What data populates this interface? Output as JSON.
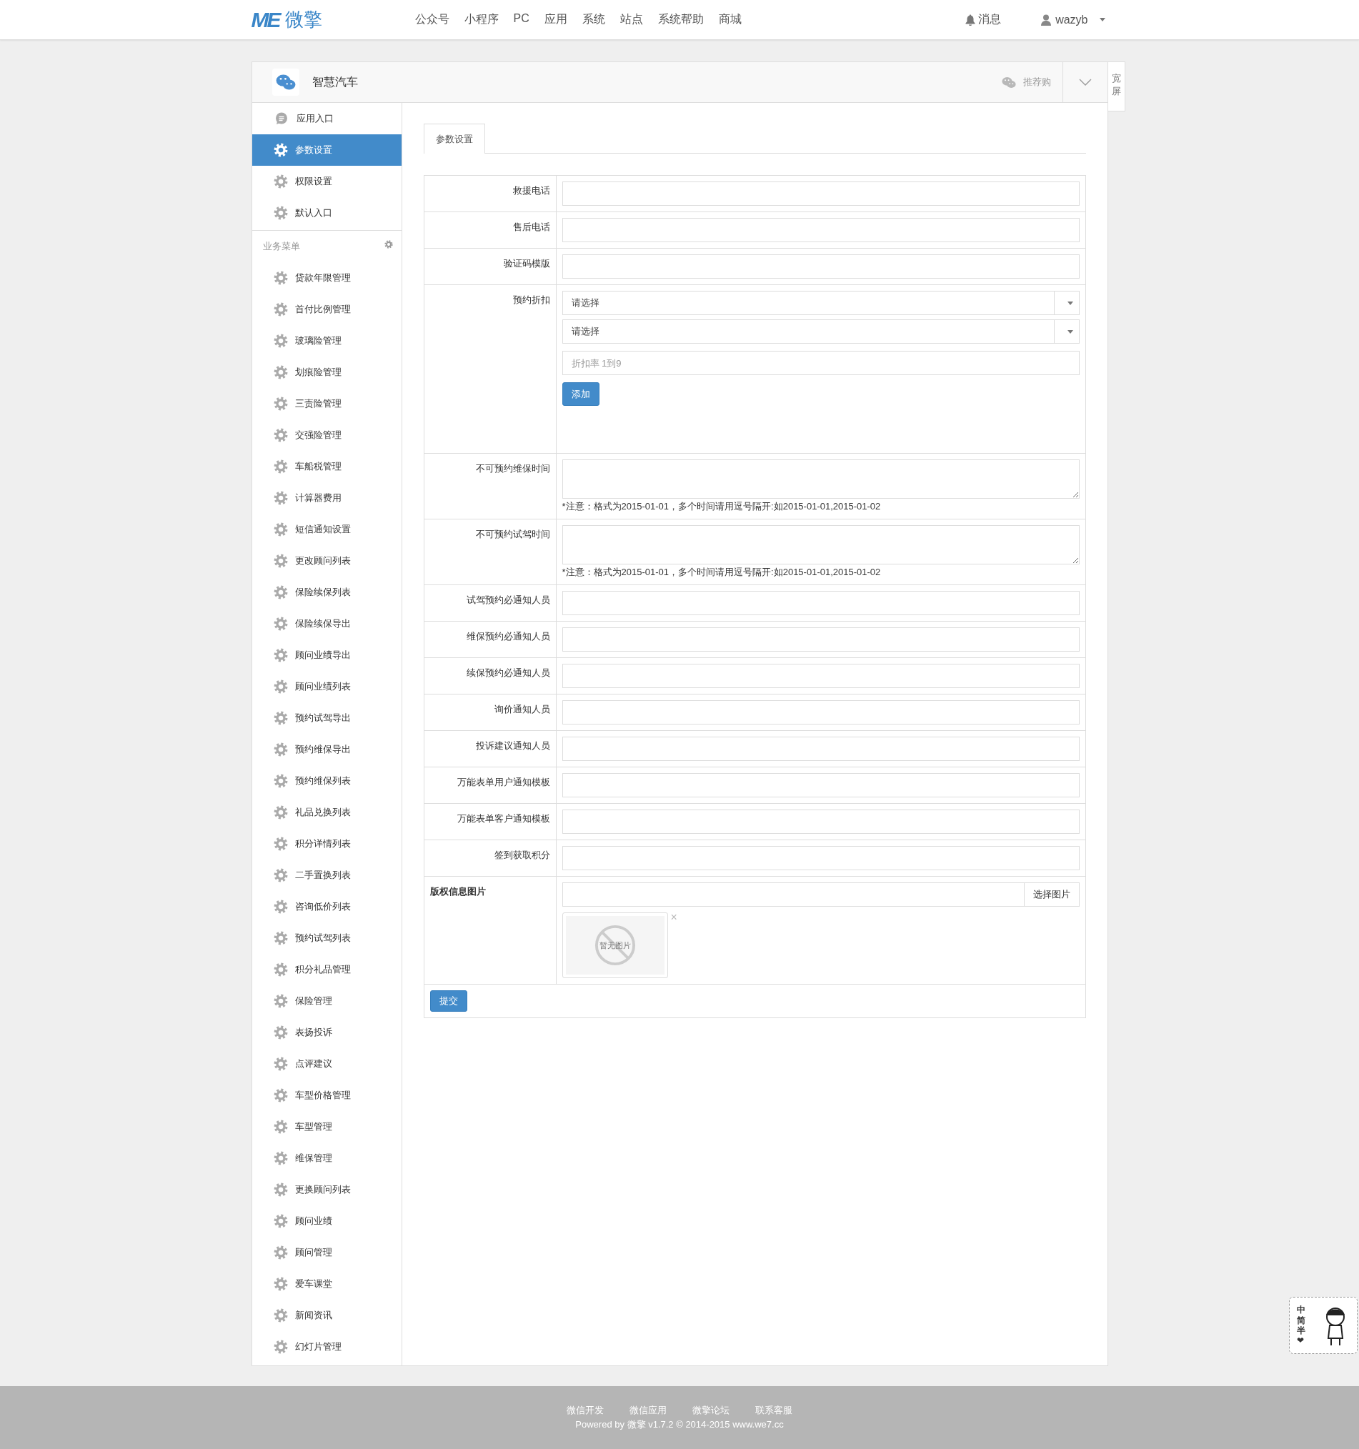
{
  "topbar": {
    "logo": {
      "mark": "ME",
      "name": "微擎"
    },
    "nav": [
      {
        "label": "公众号"
      },
      {
        "label": "小程序"
      },
      {
        "label": "PC"
      },
      {
        "label": "应用"
      },
      {
        "label": "系统"
      },
      {
        "label": "站点"
      },
      {
        "label": "系统帮助"
      },
      {
        "label": "商城"
      }
    ],
    "messages": "消息",
    "user": "wazyb"
  },
  "panel": {
    "title": "智慧汽车",
    "recommend": "推荐购",
    "widescreen": "宽屏"
  },
  "sidebar": {
    "items": [
      {
        "label": "应用入口",
        "kind": "chat",
        "selected": false
      },
      {
        "label": "参数设置",
        "kind": "gear",
        "selected": true
      },
      {
        "label": "权限设置",
        "kind": "gear",
        "selected": false
      },
      {
        "label": "默认入口",
        "kind": "gear",
        "selected": false
      }
    ],
    "section": {
      "title": "业务菜单",
      "items": [
        {
          "label": "贷款年限管理",
          "selected": false
        },
        {
          "label": "首付比例管理",
          "selected": false
        },
        {
          "label": "玻璃险管理",
          "selected": false
        },
        {
          "label": "划痕险管理",
          "selected": false
        },
        {
          "label": "三责险管理",
          "selected": false
        },
        {
          "label": "交强险管理",
          "selected": false
        },
        {
          "label": "车船税管理",
          "selected": false
        },
        {
          "label": "计算器费用",
          "selected": false
        },
        {
          "label": "短信通知设置",
          "selected": false
        },
        {
          "label": "更改顾问列表",
          "selected": false
        },
        {
          "label": "保险续保列表",
          "selected": false
        },
        {
          "label": "保险续保导出",
          "selected": false
        },
        {
          "label": "顾问业绩导出",
          "selected": false
        },
        {
          "label": "顾问业绩列表",
          "selected": false
        },
        {
          "label": "预约试驾导出",
          "selected": false
        },
        {
          "label": "预约维保导出",
          "selected": false
        },
        {
          "label": "预约维保列表",
          "selected": false
        },
        {
          "label": "礼品兑换列表",
          "selected": false
        },
        {
          "label": "积分详情列表",
          "selected": false
        },
        {
          "label": "二手置换列表",
          "selected": false
        },
        {
          "label": "咨询低价列表",
          "selected": false
        },
        {
          "label": "预约试驾列表",
          "selected": false
        },
        {
          "label": "积分礼品管理",
          "selected": false
        },
        {
          "label": "保险管理",
          "selected": false
        },
        {
          "label": "表扬投诉",
          "selected": false
        },
        {
          "label": "点评建议",
          "selected": false
        },
        {
          "label": "车型价格管理",
          "selected": false
        },
        {
          "label": "车型管理",
          "selected": false
        },
        {
          "label": "维保管理",
          "selected": false
        },
        {
          "label": "更换顾问列表",
          "selected": false
        },
        {
          "label": "顾问业绩",
          "selected": false
        },
        {
          "label": "顾问管理",
          "selected": false
        },
        {
          "label": "爱车课堂",
          "selected": false
        },
        {
          "label": "新闻资讯",
          "selected": false
        },
        {
          "label": "幻灯片管理",
          "selected": false
        }
      ]
    }
  },
  "tabs": [
    {
      "label": "参数设置",
      "selected": true
    }
  ],
  "form": {
    "rows": [
      {
        "kind": "text",
        "label": "救援电话"
      },
      {
        "kind": "text",
        "label": "售后电话"
      },
      {
        "kind": "text",
        "label": "验证码模版"
      },
      {
        "kind": "discount",
        "label": "预约折扣",
        "selects": [
          {
            "value": "请选择"
          },
          {
            "value": "请选择"
          }
        ],
        "input": {
          "placeholder": "折扣率 1到9"
        },
        "button": "添加"
      },
      {
        "kind": "textarea",
        "label": "不可预约维保时间",
        "note": "*注意：格式为2015-01-01，多个时间请用逗号隔开:如2015-01-01,2015-01-02"
      },
      {
        "kind": "textarea",
        "label": "不可预约试驾时间",
        "note": "*注意：格式为2015-01-01，多个时间请用逗号隔开:如2015-01-01,2015-01-02"
      },
      {
        "kind": "text",
        "label": "试驾预约必通知人员"
      },
      {
        "kind": "text",
        "label": "维保预约必通知人员"
      },
      {
        "kind": "text",
        "label": "续保预约必通知人员"
      },
      {
        "kind": "text",
        "label": "询价通知人员"
      },
      {
        "kind": "text",
        "label": "投诉建议通知人员"
      },
      {
        "kind": "text",
        "label": "万能表单用户通知模板"
      },
      {
        "kind": "text",
        "label": "万能表单客户通知模板"
      },
      {
        "kind": "text",
        "label": "签到获取积分"
      },
      {
        "kind": "image",
        "label": "版权信息图片",
        "button": "选择图片",
        "preview": "暂无图片",
        "remove": "×"
      }
    ],
    "submit": "提交"
  },
  "footer": {
    "links": [
      "微信开发",
      "微信应用",
      "微擎论坛",
      "联系客服"
    ],
    "copyright": "Powered by 微擎 v1.7.2 © 2014-2015 www.we7.cc"
  },
  "ime_widget": {
    "chars": [
      "中",
      "简",
      "半",
      "❤"
    ]
  }
}
